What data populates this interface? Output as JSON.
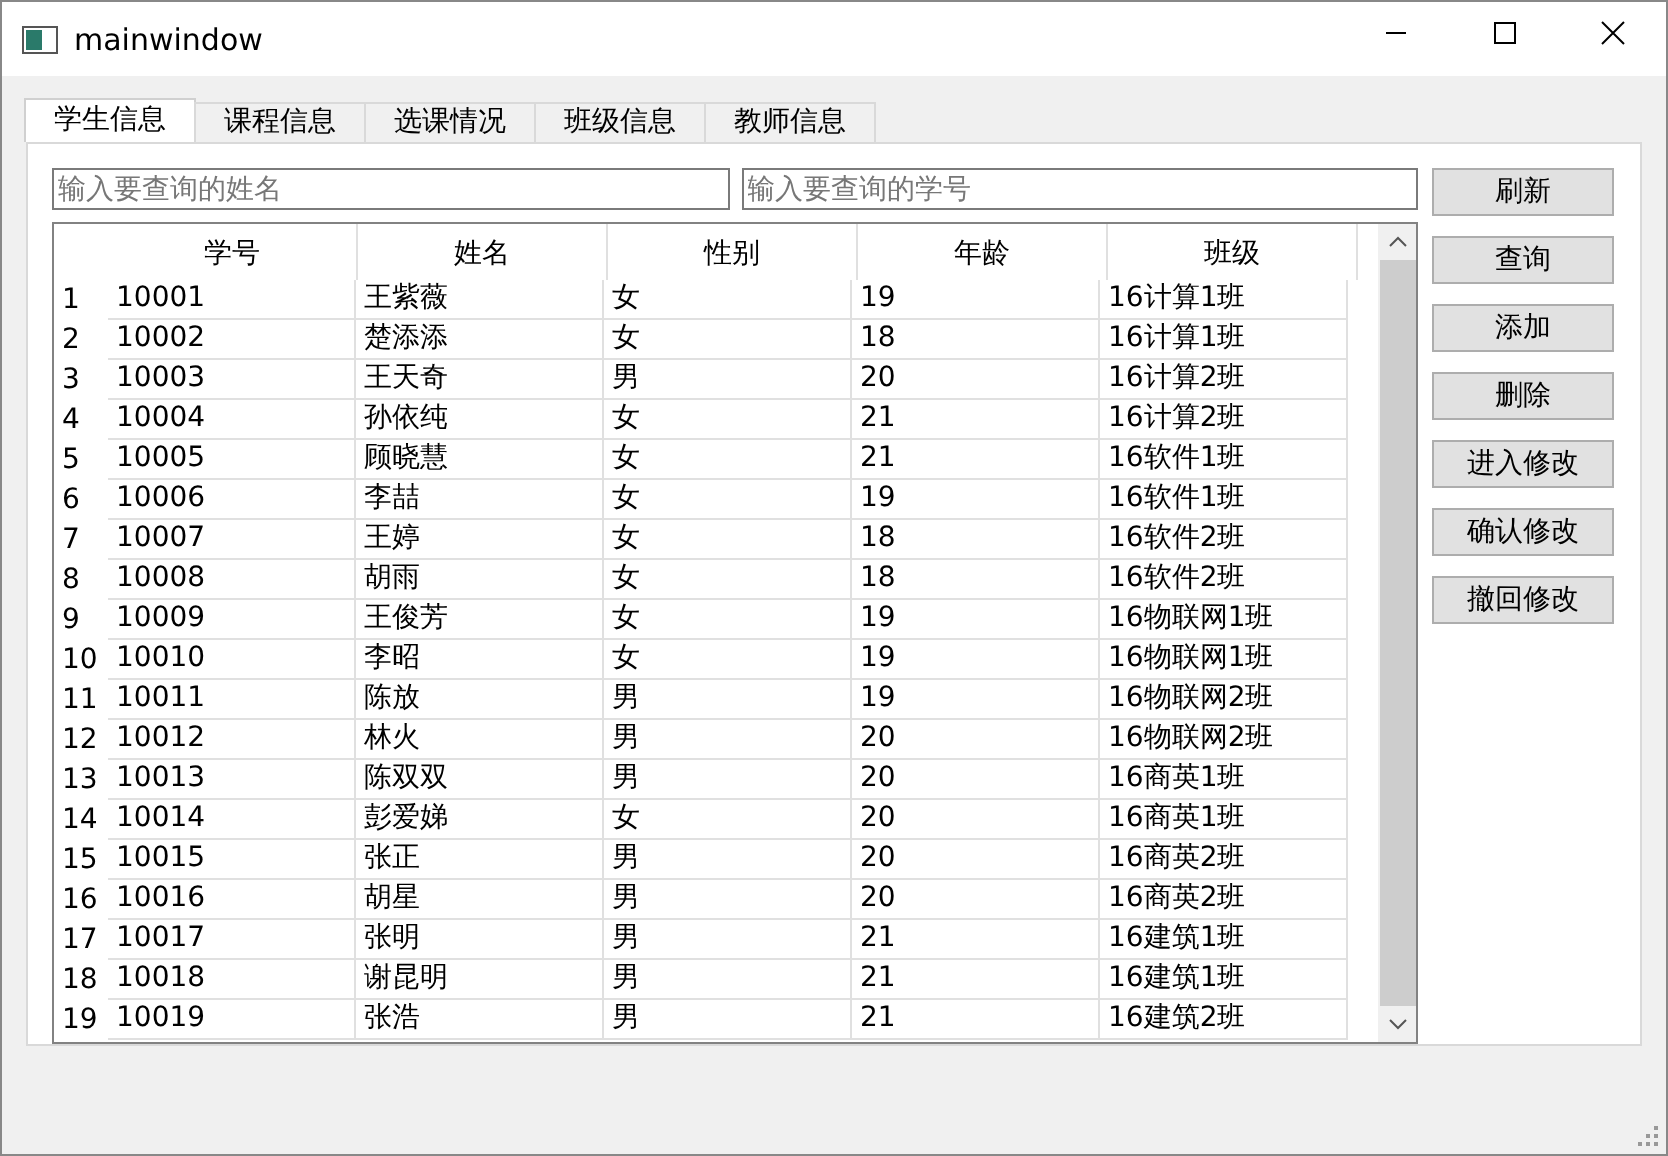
{
  "window": {
    "title": "mainwindow"
  },
  "tabs": [
    {
      "label": "学生信息",
      "selected": true
    },
    {
      "label": "课程信息",
      "selected": false
    },
    {
      "label": "选课情况",
      "selected": false
    },
    {
      "label": "班级信息",
      "selected": false
    },
    {
      "label": "教师信息",
      "selected": false
    }
  ],
  "search": {
    "name_placeholder": "输入要查询的姓名",
    "id_placeholder": "输入要查询的学号"
  },
  "table": {
    "columns": [
      "学号",
      "姓名",
      "性别",
      "年龄",
      "班级"
    ],
    "rows": [
      {
        "index": "1",
        "cells": [
          "10001",
          "王紫薇",
          "女",
          "19",
          "16计算1班"
        ]
      },
      {
        "index": "2",
        "cells": [
          "10002",
          "楚添添",
          "女",
          "18",
          "16计算1班"
        ]
      },
      {
        "index": "3",
        "cells": [
          "10003",
          "王天奇",
          "男",
          "20",
          "16计算2班"
        ]
      },
      {
        "index": "4",
        "cells": [
          "10004",
          "孙依纯",
          "女",
          "21",
          "16计算2班"
        ]
      },
      {
        "index": "5",
        "cells": [
          "10005",
          "顾晓慧",
          "女",
          "21",
          "16软件1班"
        ]
      },
      {
        "index": "6",
        "cells": [
          "10006",
          "李喆",
          "女",
          "19",
          "16软件1班"
        ]
      },
      {
        "index": "7",
        "cells": [
          "10007",
          "王婷",
          "女",
          "18",
          "16软件2班"
        ]
      },
      {
        "index": "8",
        "cells": [
          "10008",
          "胡雨",
          "女",
          "18",
          "16软件2班"
        ]
      },
      {
        "index": "9",
        "cells": [
          "10009",
          "王俊芳",
          "女",
          "19",
          "16物联网1班"
        ]
      },
      {
        "index": "10",
        "cells": [
          "10010",
          "李昭",
          "女",
          "19",
          "16物联网1班"
        ]
      },
      {
        "index": "11",
        "cells": [
          "10011",
          "陈放",
          "男",
          "19",
          "16物联网2班"
        ]
      },
      {
        "index": "12",
        "cells": [
          "10012",
          "林火",
          "男",
          "20",
          "16物联网2班"
        ]
      },
      {
        "index": "13",
        "cells": [
          "10013",
          "陈双双",
          "男",
          "20",
          "16商英1班"
        ]
      },
      {
        "index": "14",
        "cells": [
          "10014",
          "彭爱娣",
          "女",
          "20",
          "16商英1班"
        ]
      },
      {
        "index": "15",
        "cells": [
          "10015",
          "张正",
          "男",
          "20",
          "16商英2班"
        ]
      },
      {
        "index": "16",
        "cells": [
          "10016",
          "胡星",
          "男",
          "20",
          "16商英2班"
        ]
      },
      {
        "index": "17",
        "cells": [
          "10017",
          "张明",
          "男",
          "21",
          "16建筑1班"
        ]
      },
      {
        "index": "18",
        "cells": [
          "10018",
          "谢昆明",
          "男",
          "21",
          "16建筑1班"
        ]
      },
      {
        "index": "19",
        "cells": [
          "10019",
          "张浩",
          "男",
          "21",
          "16建筑2班"
        ]
      }
    ]
  },
  "buttons": [
    "刷新",
    "查询",
    "添加",
    "删除",
    "进入修改",
    "确认修改",
    "撤回修改"
  ]
}
